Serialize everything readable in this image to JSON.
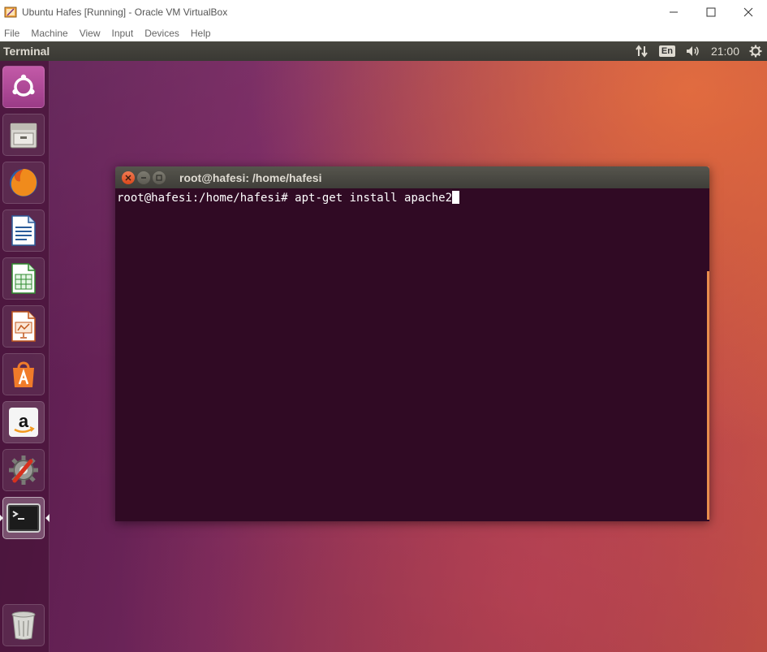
{
  "host": {
    "title": "Ubuntu Hafes [Running] - Oracle VM VirtualBox",
    "controls": {
      "minimize": "—",
      "maximize": "☐",
      "close": "✕"
    },
    "menu": [
      "File",
      "Machine",
      "View",
      "Input",
      "Devices",
      "Help"
    ]
  },
  "panel": {
    "app_title": "Terminal",
    "keyboard_layout": "En",
    "time": "21:00"
  },
  "launcher": {
    "items": [
      {
        "name": "ubuntu-dash-icon"
      },
      {
        "name": "files-icon"
      },
      {
        "name": "firefox-icon"
      },
      {
        "name": "libreoffice-writer-icon"
      },
      {
        "name": "libreoffice-calc-icon"
      },
      {
        "name": "libreoffice-impress-icon"
      },
      {
        "name": "ubuntu-software-icon"
      },
      {
        "name": "amazon-icon"
      },
      {
        "name": "system-settings-icon"
      },
      {
        "name": "terminal-icon"
      },
      {
        "name": "trash-icon"
      }
    ]
  },
  "terminal": {
    "title": "root@hafesi: /home/hafesi",
    "prompt": "root@hafesi:/home/hafesi# ",
    "command": "apt-get install apache2"
  },
  "colors": {
    "terminal_bg": "#300a24",
    "close_button": "#e8592c",
    "scroll_indicator": "#e88d4d"
  }
}
